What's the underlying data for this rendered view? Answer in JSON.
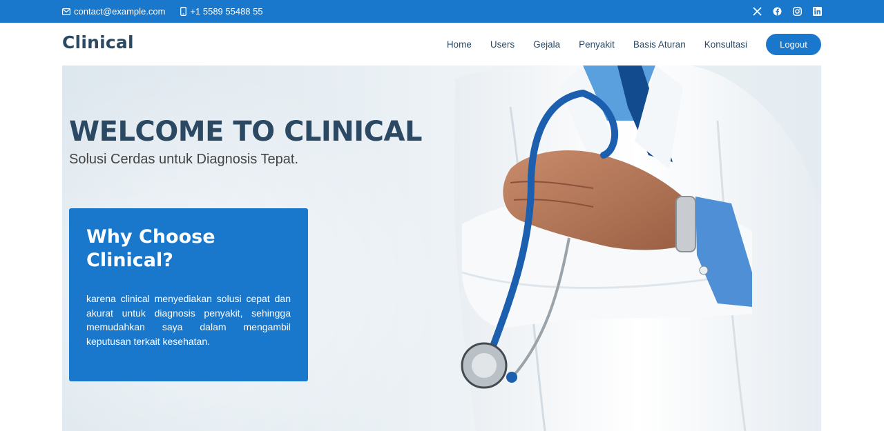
{
  "topbar": {
    "email": "contact@example.com",
    "phone": "+1 5589 55488 55",
    "social_icons": [
      "x-twitter-icon",
      "facebook-icon",
      "instagram-icon",
      "linkedin-icon"
    ]
  },
  "header": {
    "logo": "Clinical",
    "nav": [
      "Home",
      "Users",
      "Gejala",
      "Penyakit",
      "Basis Aturan",
      "Konsultasi"
    ],
    "logout_label": "Logout"
  },
  "hero": {
    "title": "WELCOME TO CLINICAL",
    "subtitle": "Solusi Cerdas untuk Diagnosis Tepat.",
    "why_title": "Why Choose Clinical?",
    "why_text": "karena clinical menyediakan solusi cepat dan akurat untuk diagnosis penyakit, sehingga memudahkan saya dalam mengambil keputusan terkait kesehatan."
  },
  "colors": {
    "primary": "#1977cc",
    "heading": "#2c4964",
    "white": "#ffffff"
  }
}
